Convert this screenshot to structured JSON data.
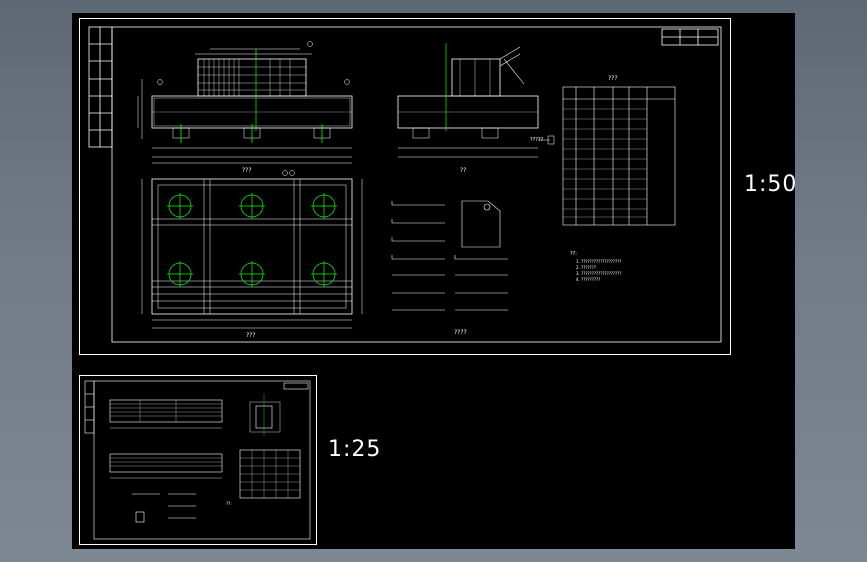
{
  "viewport": {
    "background": "#000000",
    "line_color": "#ffffff",
    "accent_green": "#00ff00",
    "accent_cyan": "#00ffff",
    "accent_yellow": "#ffff00"
  },
  "sheets": [
    {
      "id": "sheet-1",
      "scale": "1:50"
    },
    {
      "id": "sheet-2",
      "scale": "1:25"
    }
  ],
  "sheet1": {
    "title_rows": [
      "?",
      "?",
      "?",
      "?",
      "?",
      "?",
      "?"
    ],
    "corner_title": [
      "??",
      "?",
      "??",
      "?",
      "?",
      "???"
    ],
    "view_titles": {
      "elevation": "???",
      "side": "??",
      "plan": "???",
      "rebar": "????"
    },
    "table_title": "???",
    "table_headers": [
      "??",
      "??",
      "???",
      "??",
      "??",
      "??"
    ],
    "table_rows": [
      [
        "1",
        "?8",
        "???",
        "??",
        "??"
      ],
      [
        "2",
        "?8",
        "???",
        "??",
        "??"
      ],
      [
        "3",
        "?8",
        "???",
        "??",
        "??"
      ],
      [
        "4",
        "?8",
        "???",
        "??",
        "??"
      ],
      [
        "5",
        "?8",
        "???",
        "??",
        "??"
      ],
      [
        "6",
        "?8",
        "???",
        "??",
        "??"
      ],
      [
        "7",
        "?8",
        "???",
        "??",
        "??"
      ],
      [
        "8",
        "?8",
        "???",
        "??",
        "??"
      ],
      [
        "9",
        "?8",
        "???",
        "??",
        "??"
      ],
      [
        "10",
        "?8",
        "???",
        "??",
        "??"
      ],
      [
        "11",
        "?8",
        "???",
        "??",
        "??"
      ],
      [
        "12",
        "?8",
        "???",
        "??",
        "??"
      ],
      [
        "13",
        "?8",
        "???",
        "??",
        "??"
      ]
    ],
    "notes_title": "??:",
    "notes": [
      "1. ???????????????????",
      "2. ???????",
      "3. ???????????????????",
      "4. ?????????"
    ],
    "dimension_label": "?????"
  },
  "sheet2": {
    "view_titles": [
      "???",
      "??",
      "??"
    ],
    "notes_title": "??:"
  }
}
